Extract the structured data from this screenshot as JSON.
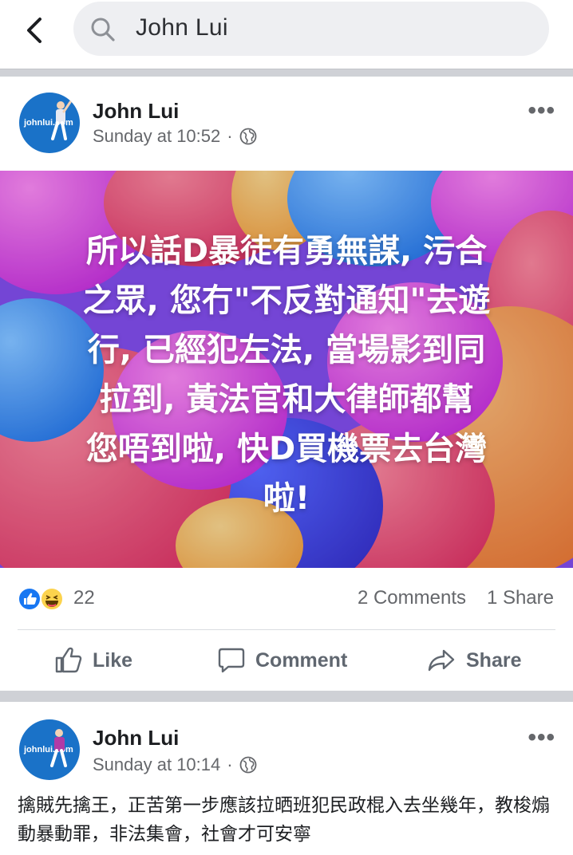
{
  "search": {
    "query": "John Lui",
    "back_icon": "chevron-left-icon",
    "search_icon": "search-icon"
  },
  "posts": [
    {
      "author": "John Lui",
      "avatar_text": "johnlui.com",
      "time": "Sunday at 10:52",
      "separator": "·",
      "privacy_icon": "globe-icon",
      "more": "•••",
      "image_text": "所以話D暴徒有勇無謀, 污合\n之眾, 您冇\"不反對通知\"去遊\n行, 已經犯左法, 當場影到同\n拉到, 黃法官和大律師都幫\n您唔到啦, 快D買機票去台灣\n啦!",
      "reactions": {
        "icons": [
          "like-reaction-icon",
          "haha-reaction-icon"
        ],
        "count": "22"
      },
      "comments": "2 Comments",
      "shares": "1 Share",
      "actions": {
        "like": "Like",
        "comment": "Comment",
        "share": "Share"
      }
    },
    {
      "author": "John Lui",
      "avatar_text": "johnlui.com",
      "time": "Sunday at 10:14",
      "separator": "·",
      "privacy_icon": "globe-icon",
      "more": "•••",
      "text": "擒賊先擒王，正苦第一步應該拉晒班犯民政棍入去坐幾年，教梭煽動暴動罪，非法集會，社會才可安寧"
    }
  ],
  "colors": {
    "brand_blue": "#1877f2",
    "bg_gray": "#cfd1d6",
    "meta_gray": "#65676b"
  }
}
